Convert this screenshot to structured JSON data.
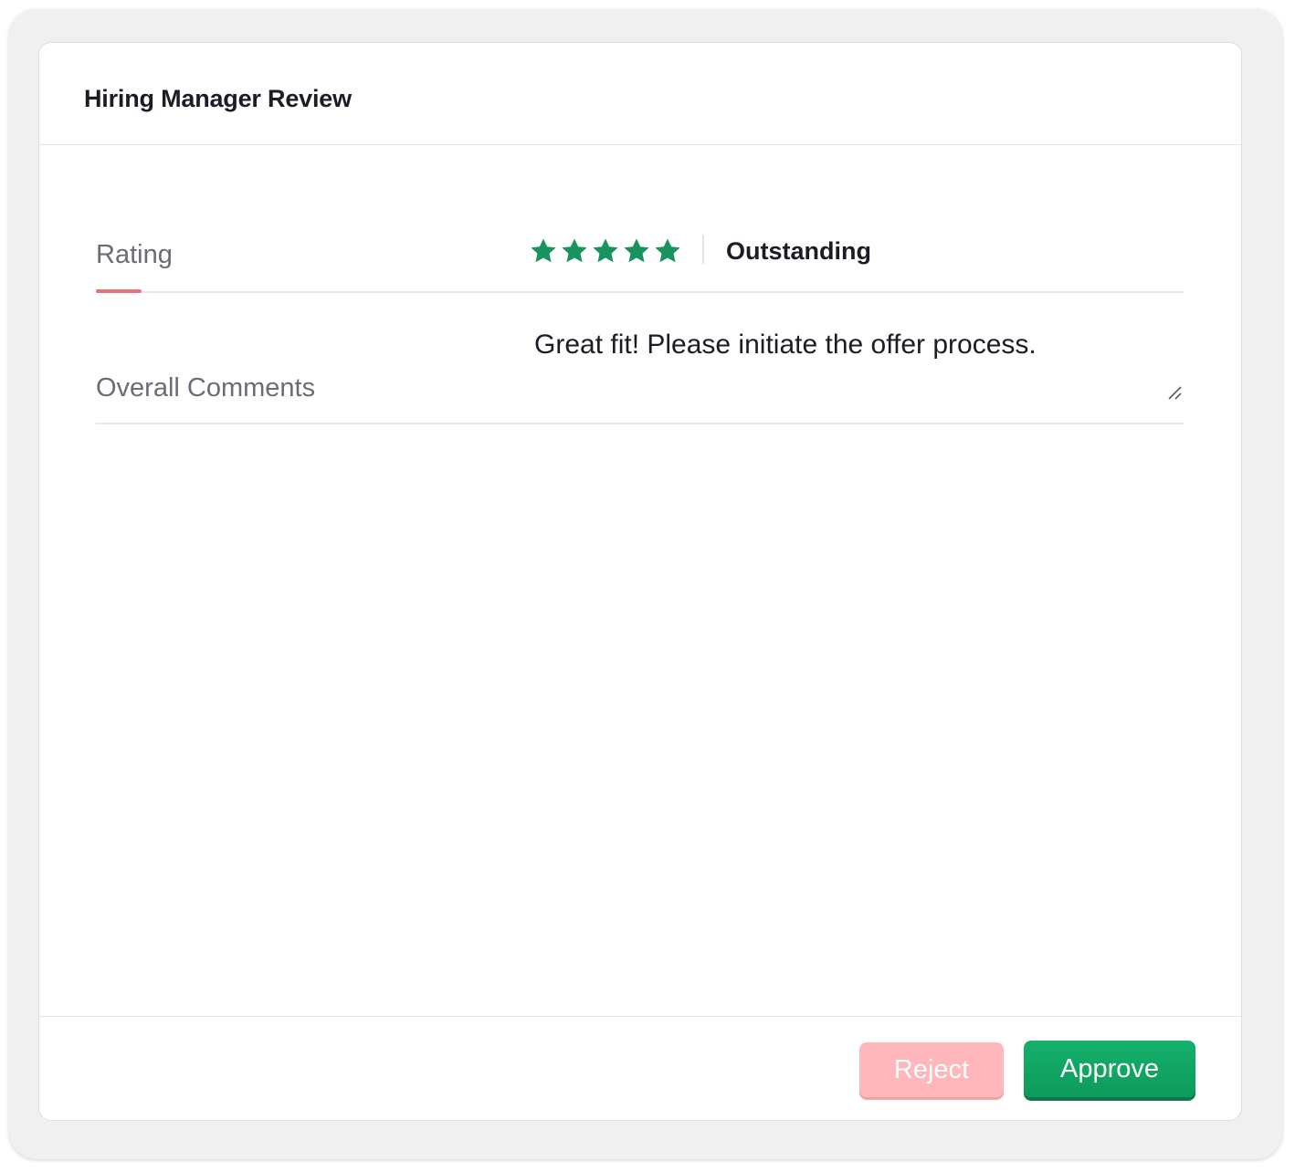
{
  "panel": {
    "title": "Hiring Manager Review"
  },
  "rating": {
    "label": "Rating",
    "stars_total": 5,
    "stars_filled": 5,
    "value_text": "Outstanding",
    "star_color": "#17935f"
  },
  "comments": {
    "label": "Overall Comments",
    "value": "Great fit! Please initiate the offer process."
  },
  "actions": {
    "reject_label": "Reject",
    "approve_label": "Approve",
    "reject_color": "#ffb7bb",
    "approve_color": "#13a865"
  },
  "icons": {
    "star": "star-icon",
    "resize": "resize-handle-icon"
  }
}
